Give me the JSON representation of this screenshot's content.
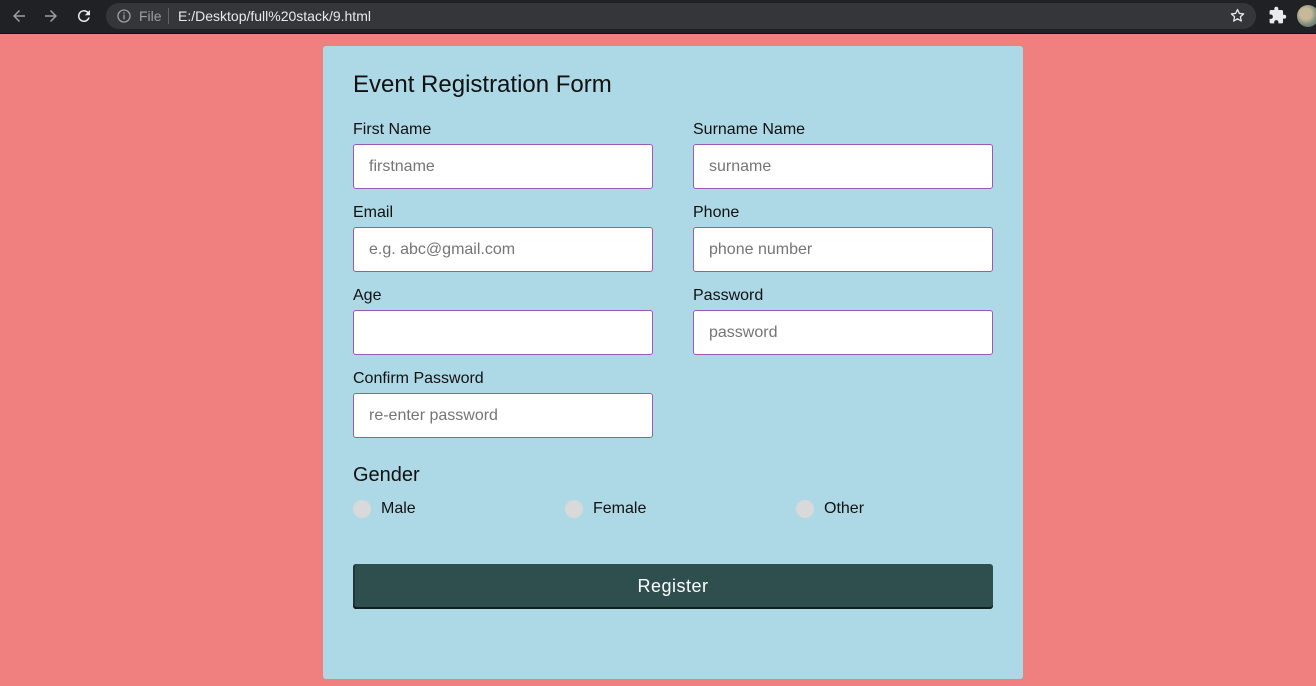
{
  "browser": {
    "file_label": "File",
    "url": "E:/Desktop/full%20stack/9.html",
    "icons": [
      "back-arrow-icon",
      "forward-arrow-icon",
      "reload-icon",
      "info-icon",
      "star-icon",
      "extensions-icon"
    ]
  },
  "form": {
    "title": "Event Registration Form",
    "fields": {
      "first_name": {
        "label": "First Name",
        "placeholder": "firstname",
        "value": ""
      },
      "surname": {
        "label": "Surname Name",
        "placeholder": "surname",
        "value": ""
      },
      "email": {
        "label": "Email",
        "placeholder": "e.g. abc@gmail.com",
        "value": ""
      },
      "phone": {
        "label": "Phone",
        "placeholder": "phone number",
        "value": ""
      },
      "age": {
        "label": "Age",
        "placeholder": "",
        "value": ""
      },
      "password": {
        "label": "Password",
        "placeholder": "password",
        "value": ""
      },
      "confirm_password": {
        "label": "Confirm Password",
        "placeholder": "re-enter password",
        "value": ""
      }
    },
    "gender": {
      "title": "Gender",
      "options": [
        "Male",
        "Female",
        "Other"
      ]
    },
    "submit_label": "Register"
  },
  "colors": {
    "page_background": "#f08080",
    "card_background": "#add8e6",
    "input_border": "#9b59b6",
    "button_background": "#2f4f4f"
  }
}
